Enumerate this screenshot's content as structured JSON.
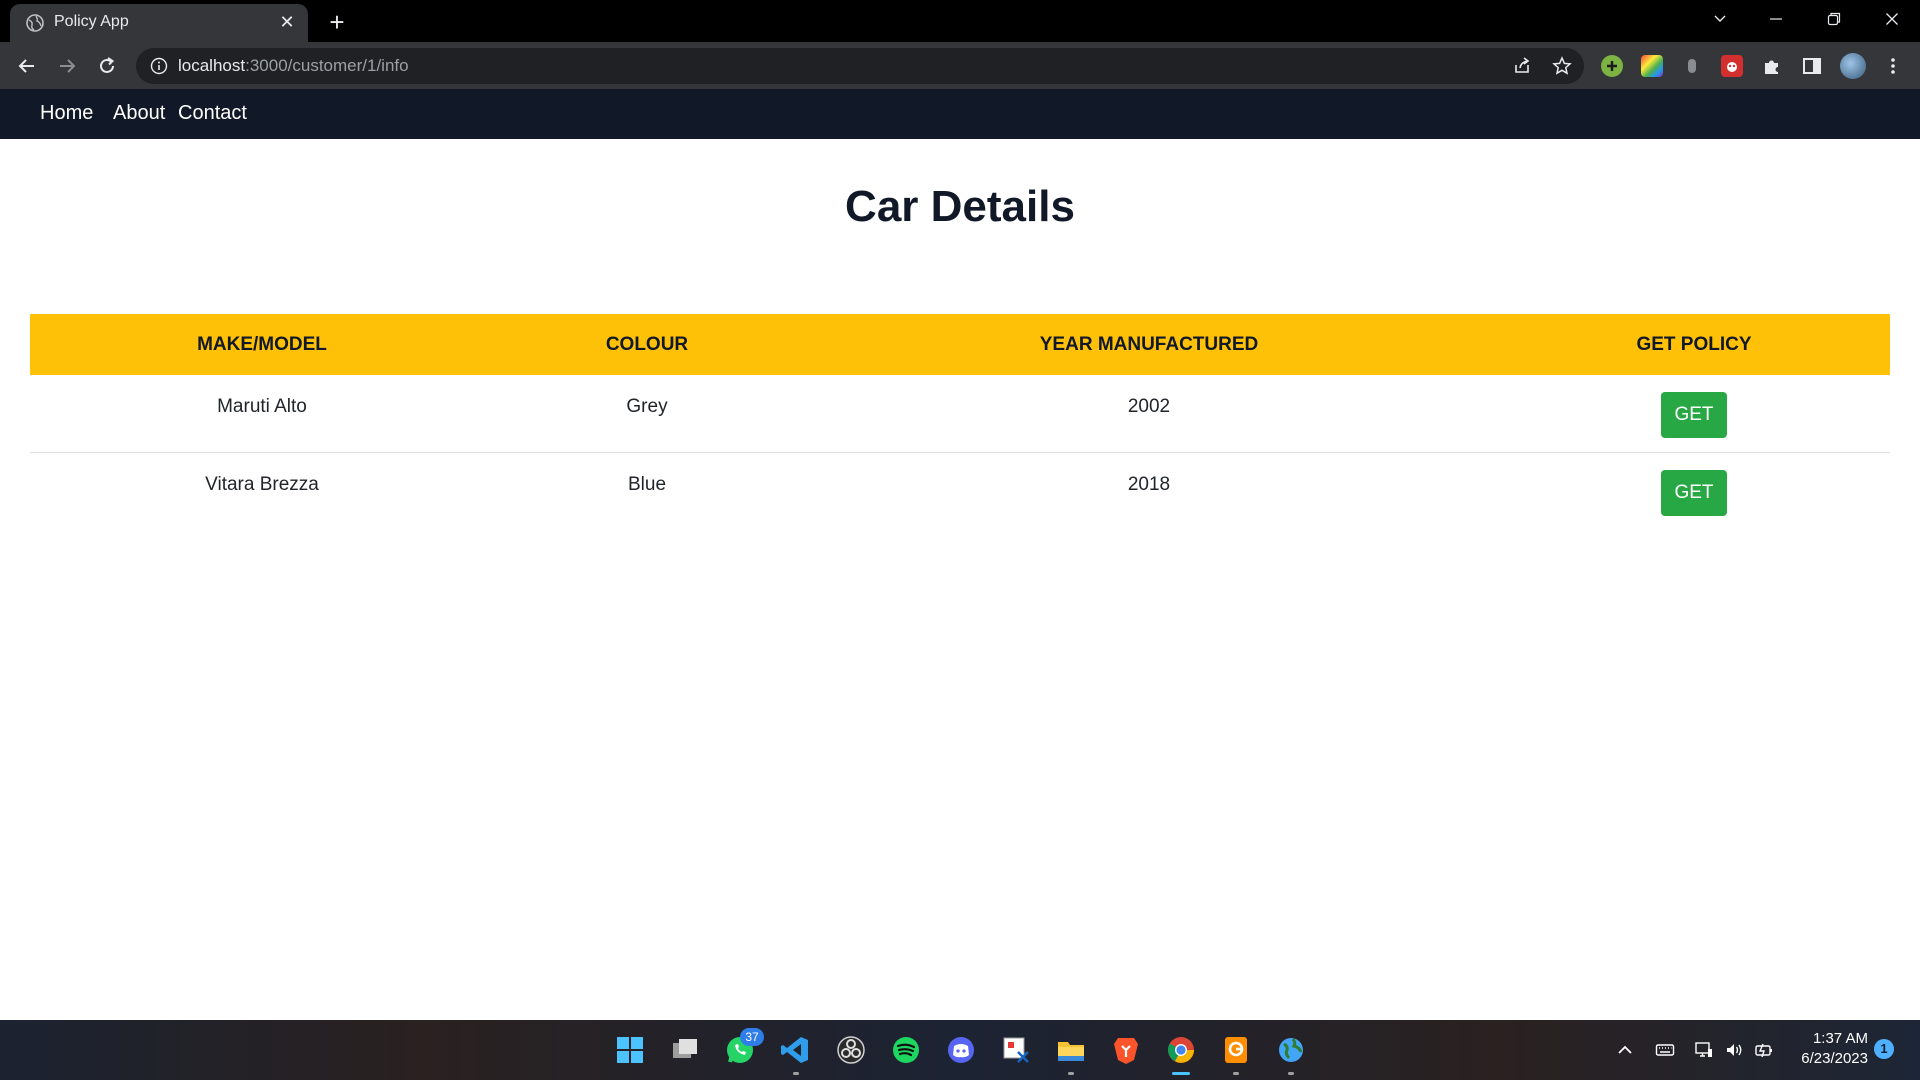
{
  "browser": {
    "tab_title": "Policy App",
    "tab_close": "✕",
    "new_tab": "+",
    "url_host": "localhost",
    "url_path": ":3000/customer/1/info"
  },
  "nav": {
    "links": [
      "Home",
      "About",
      "Contact"
    ]
  },
  "page": {
    "title": "Car Details"
  },
  "table": {
    "headers": [
      "MAKE/MODEL",
      "COLOUR",
      "YEAR MANUFACTURED",
      "GET POLICY"
    ],
    "rows": [
      {
        "make_model": "Maruti Alto",
        "colour": "Grey",
        "year": "2002",
        "action": "GET"
      },
      {
        "make_model": "Vitara Brezza",
        "colour": "Blue",
        "year": "2018",
        "action": "GET"
      }
    ]
  },
  "colors": {
    "navbar": "#111827",
    "table_header": "#ffc107",
    "get_button": "#28a745"
  },
  "taskbar": {
    "whatsapp_badge": "37",
    "time": "1:37 AM",
    "date": "6/23/2023",
    "notification_count": "1"
  }
}
